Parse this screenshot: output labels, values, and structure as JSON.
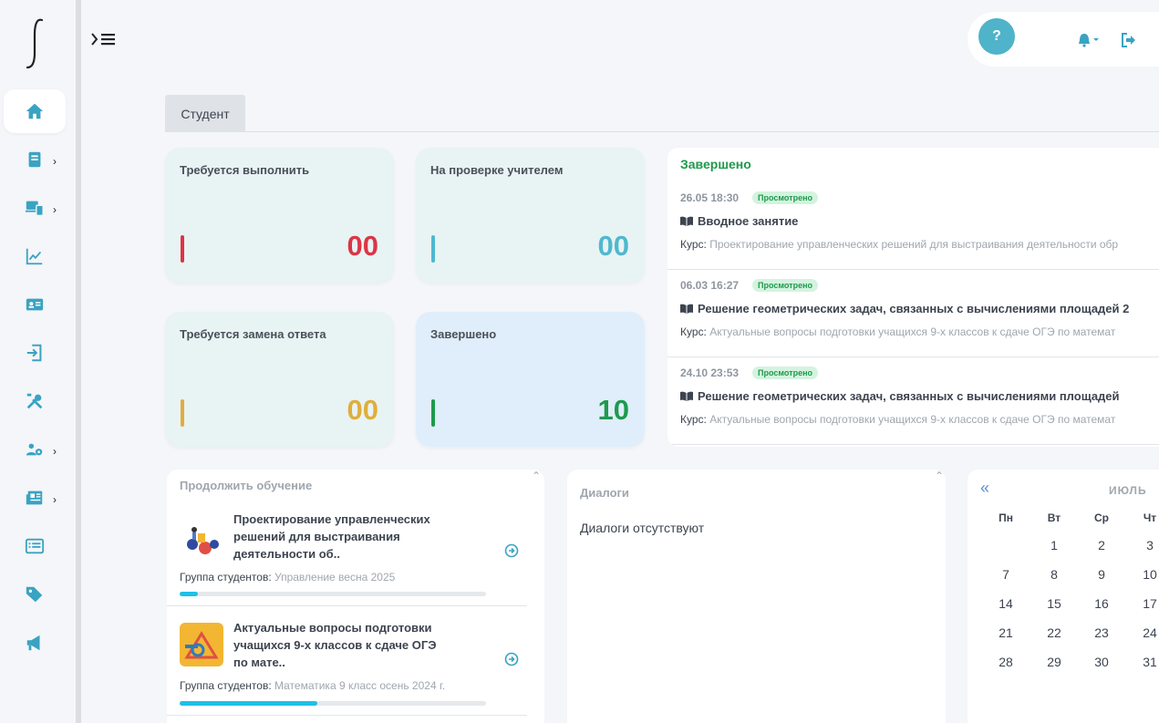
{
  "colors": {
    "accent": "#4fb3c9",
    "red": "#dc3545",
    "teal": "#4fb8cf",
    "yellow": "#e0ae3c",
    "green": "#1e9a4c",
    "progress": "#1ec0e6"
  },
  "sidebar": {
    "items": [
      {
        "icon": "home-icon",
        "active": true,
        "chevron": false
      },
      {
        "icon": "book-icon",
        "active": false,
        "chevron": true
      },
      {
        "icon": "devices-icon",
        "active": false,
        "chevron": true
      },
      {
        "icon": "chart-line-icon",
        "active": false,
        "chevron": false
      },
      {
        "icon": "id-card-icon",
        "active": false,
        "chevron": false
      },
      {
        "icon": "sign-in-icon",
        "active": false,
        "chevron": false
      },
      {
        "icon": "tools-icon",
        "active": false,
        "chevron": false
      },
      {
        "icon": "users-cog-icon",
        "active": false,
        "chevron": true
      },
      {
        "icon": "newspaper-icon",
        "active": false,
        "chevron": true
      },
      {
        "icon": "list-alt-icon",
        "active": false,
        "chevron": false
      },
      {
        "icon": "tags-icon",
        "active": false,
        "chevron": false
      },
      {
        "icon": "bullhorn-icon",
        "active": false,
        "chevron": false
      }
    ]
  },
  "header": {
    "help_label": "?",
    "menu_chevron": ">"
  },
  "tabs": [
    {
      "label": "Студент"
    }
  ],
  "stats": [
    {
      "title": "Требуется выполнить",
      "value": "00",
      "color": "#dc3545"
    },
    {
      "title": "На проверке учителем",
      "value": "00",
      "color": "#4fb8cf"
    },
    {
      "title": "Требуется замена ответа",
      "value": "00",
      "color": "#e0ae3c"
    },
    {
      "title": "Завершено",
      "value": "10",
      "color": "#1e9a4c"
    }
  ],
  "completed": {
    "title": "Завершено",
    "course_label": "Курс:",
    "items": [
      {
        "date": "26.05 18:30",
        "badge": "Просмотрено",
        "lesson": "Вводное занятие",
        "course": "Проектирование управленческих решений для выстраивания деятельности обр"
      },
      {
        "date": "06.03 16:27",
        "badge": "Просмотрено",
        "lesson": "Решение геометрических задач, связанных с вычислениями площадей 2",
        "course": "Актуальные вопросы подготовки учащихся 9-х классов к сдаче ОГЭ по математ"
      },
      {
        "date": "24.10 23:53",
        "badge": "Просмотрено",
        "lesson": "Решение геометрических задач, связанных с вычислениями площадей",
        "course": "Актуальные вопросы подготовки учащихся 9-х классов к сдаче ОГЭ по математ"
      }
    ]
  },
  "continue": {
    "title": "Продолжить обучение",
    "group_label": "Группа студентов:",
    "courses": [
      {
        "title": "Проектирование управленческих решений для выстраивания деятельности об..",
        "group": "Управление весна 2025",
        "progress": 0.06
      },
      {
        "title": "Актуальные вопросы подготовки учащихся 9-х классов к сдаче ОГЭ по мате..",
        "group": "Математика 9 класс осень 2024 г.",
        "progress": 0.45
      }
    ]
  },
  "dialogs": {
    "title": "Диалоги",
    "empty": "Диалоги отсутствуют"
  },
  "calendar": {
    "prev": "«",
    "month": "ИЮЛЬ",
    "weekdays": [
      "Пн",
      "Вт",
      "Ср",
      "Чт"
    ],
    "weeks": [
      [
        "",
        "1",
        "2",
        "3"
      ],
      [
        "7",
        "8",
        "9",
        "10"
      ],
      [
        "14",
        "15",
        "16",
        "17"
      ],
      [
        "21",
        "22",
        "23",
        "24"
      ],
      [
        "28",
        "29",
        "30",
        "31"
      ]
    ]
  }
}
